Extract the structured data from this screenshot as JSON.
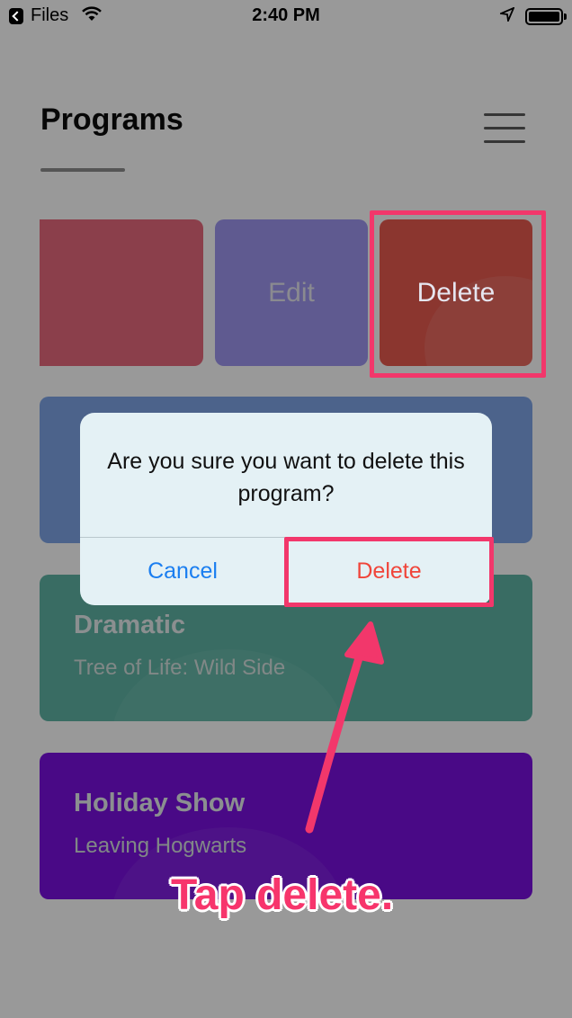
{
  "status_bar": {
    "back_app": "Files",
    "time": "2:40 PM",
    "icons": [
      "back-icon",
      "wifi-icon",
      "location-arrow-icon",
      "battery-icon"
    ]
  },
  "header": {
    "title": "Programs",
    "menu_icon": "hamburger-menu-icon"
  },
  "swipe_actions": {
    "edit_label": "Edit",
    "delete_label": "Delete"
  },
  "programs": [
    {
      "title": "",
      "subtitle": "",
      "color": "#7fa6e8"
    },
    {
      "title": "Dramatic",
      "subtitle": "Tree of Life: Wild Side",
      "color": "#5fb5a5"
    },
    {
      "title": "Holiday Show",
      "subtitle": "Leaving Hogwarts",
      "color": "#7a10e0"
    }
  ],
  "alert": {
    "message": "Are you sure you want to delete this program?",
    "cancel_label": "Cancel",
    "delete_label": "Delete"
  },
  "annotation": {
    "caption": "Tap delete.",
    "color": "#f2376b"
  }
}
